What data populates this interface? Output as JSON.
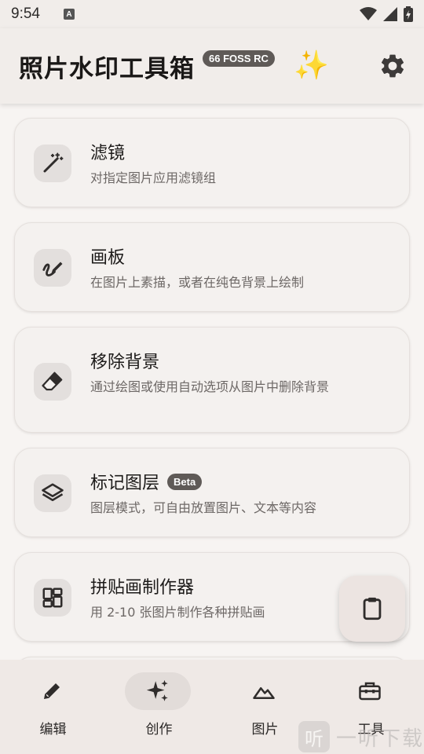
{
  "status_bar": {
    "time": "9:54",
    "notification_letter": "A"
  },
  "header": {
    "title": "照片水印工具箱",
    "version_badge": "66 FOSS RC",
    "sparkle": "✨",
    "settings_icon": "gear-icon"
  },
  "cards": [
    {
      "title": "滤镜",
      "description": "对指定图片应用滤镜组",
      "icon": "magic-wand-icon"
    },
    {
      "title": "画板",
      "description": "在图片上素描，或者在纯色背景上绘制",
      "icon": "draw-pen-icon"
    },
    {
      "title": "移除背景",
      "description": "通过绘图或使用自动选项从图片中删除背景",
      "icon": "eraser-icon"
    },
    {
      "title": "标记图层",
      "badge": "Beta",
      "description": "图层模式，可自由放置图片、文本等内容",
      "icon": "layers-icon"
    },
    {
      "title": "拼贴画制作器",
      "description": "用 2-10 张图片制作各种拼贴画",
      "icon": "collage-grid-icon"
    }
  ],
  "fab": {
    "icon": "clipboard-icon"
  },
  "bottom_nav": [
    {
      "label": "编辑",
      "icon": "pencil-icon",
      "active": false
    },
    {
      "label": "创作",
      "icon": "sparkles-icon",
      "active": true
    },
    {
      "label": "图片",
      "icon": "mountain-image-icon",
      "active": false
    },
    {
      "label": "工具",
      "icon": "toolbox-icon",
      "active": false
    }
  ],
  "watermark": {
    "icon_text": "听",
    "text": "一听下载"
  },
  "colors": {
    "accent": "#5f5a57",
    "surface": "#f4f1ef",
    "background": "#f7f4f2"
  }
}
